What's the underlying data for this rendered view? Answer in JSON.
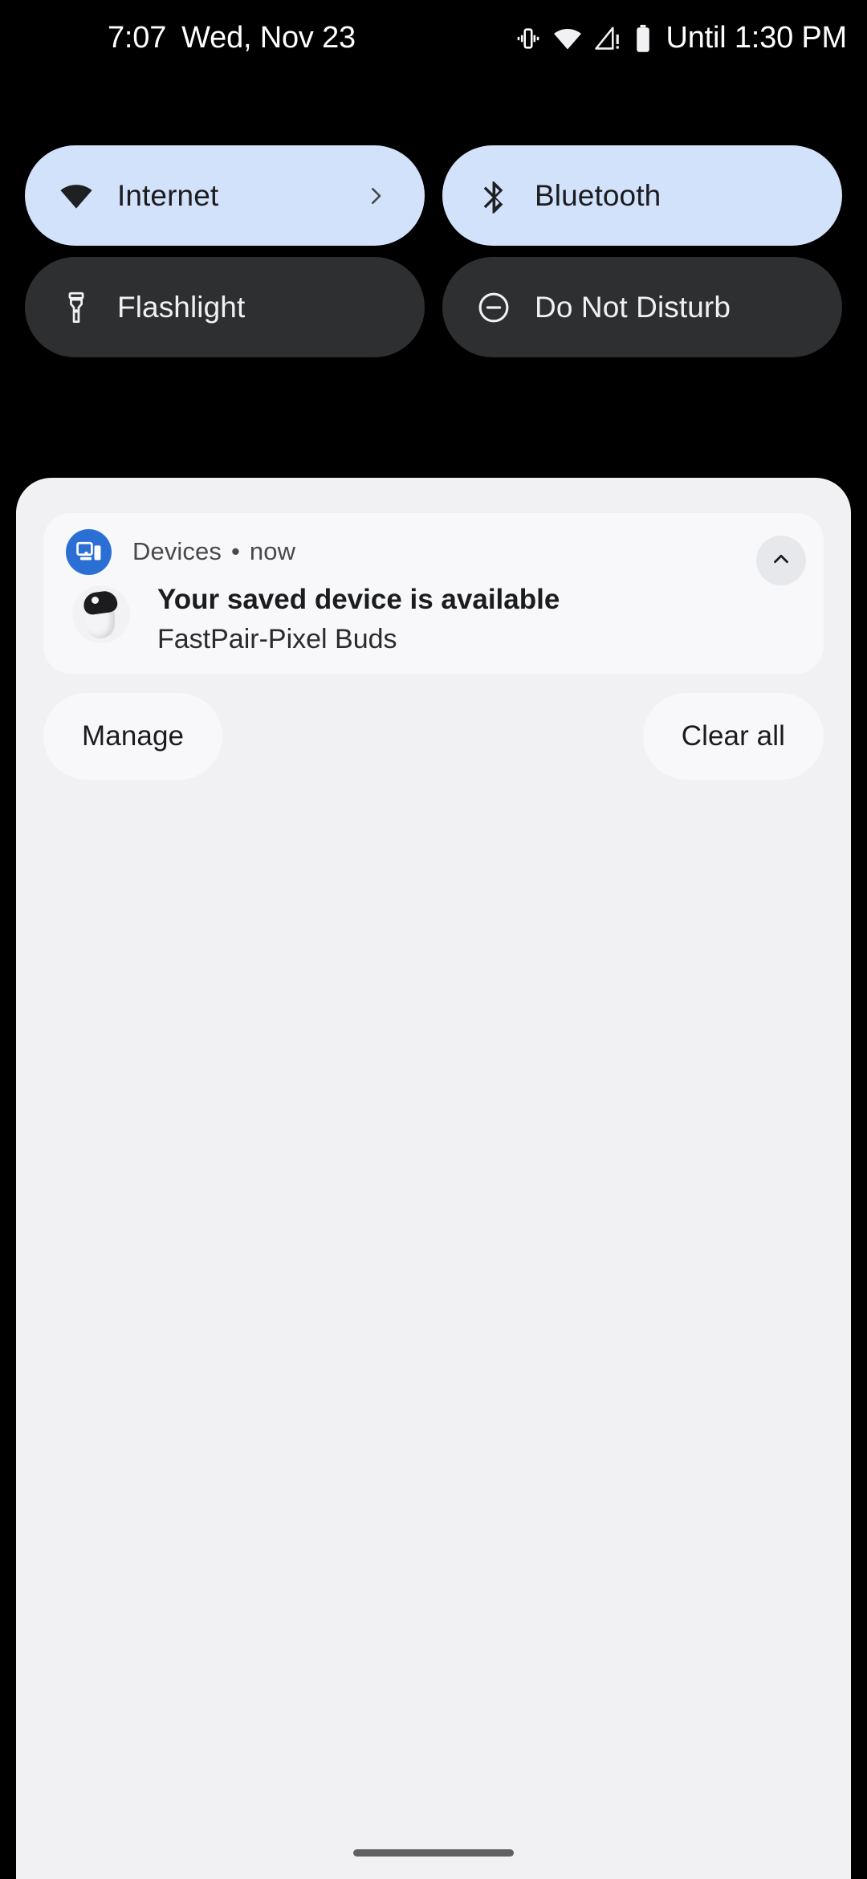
{
  "status_bar": {
    "clock": "7:07",
    "date": "Wed, Nov 23",
    "battery_status": "Until 1:30 PM",
    "icons": [
      "vibrate-icon",
      "wifi-icon",
      "mobile-signal-alert-icon",
      "battery-icon"
    ]
  },
  "quick_settings": {
    "tiles": [
      {
        "label": "Internet",
        "icon": "wifi-icon",
        "state": "on",
        "has_chevron": true
      },
      {
        "label": "Bluetooth",
        "icon": "bluetooth-icon",
        "state": "on",
        "has_chevron": false
      },
      {
        "label": "Flashlight",
        "icon": "flashlight-icon",
        "state": "off",
        "has_chevron": false
      },
      {
        "label": "Do Not Disturb",
        "icon": "do-not-disturb-icon",
        "state": "off",
        "has_chevron": false
      }
    ]
  },
  "notification_shade": {
    "notification": {
      "app_name": "Devices",
      "separator": "•",
      "time": "now",
      "app_icon": "devices-cast-icon",
      "collapse_icon": "chevron-up-icon",
      "thumbnail_icon": "pixel-buds-image",
      "title": "Your saved device is available",
      "subtitle": "FastPair-Pixel Buds"
    },
    "actions": {
      "manage_label": "Manage",
      "clear_all_label": "Clear all"
    }
  },
  "navigation": {
    "home_gesture_bar": "home-gesture-bar"
  },
  "colors": {
    "background": "#000000",
    "tile_on": "#d3e2fb",
    "tile_off": "#2d2f31",
    "shade": "#f1f1f3",
    "card": "#f8f8fa",
    "app_accent": "#2b6fd4",
    "text_dark": "#1b1c1e",
    "text_light": "#f1f1f3"
  }
}
